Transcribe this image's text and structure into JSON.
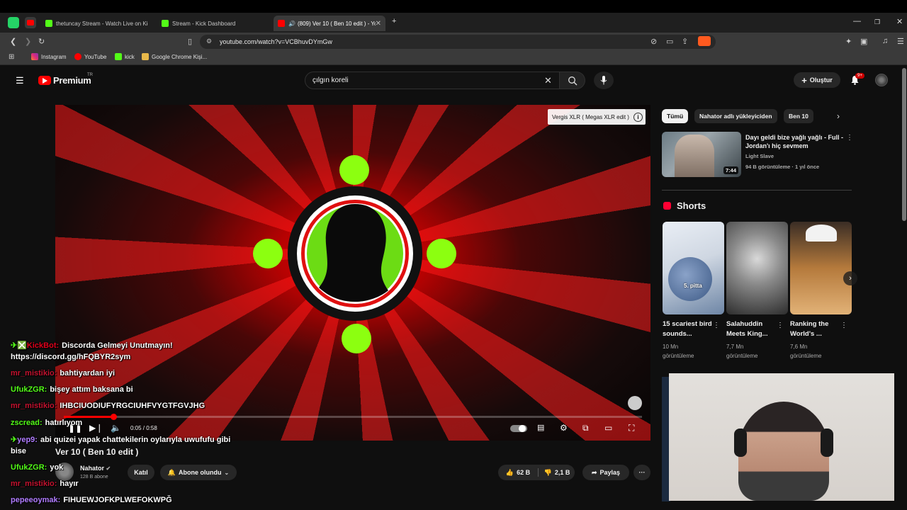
{
  "browser": {
    "tabs": [
      {
        "label": "thetuncay Stream - Watch Live on Kick",
        "active": false
      },
      {
        "label": "Stream - Kick Dashboard",
        "active": false
      },
      {
        "label": "(809) Ver 10 ( Ben 10 edit ) - YouTube",
        "active": true
      }
    ],
    "url": "youtube.com/watch?v=VCBhuvDYmGw",
    "bookmarks": [
      "Instagram",
      "YouTube",
      "kick",
      "Google Chrome Kişi..."
    ]
  },
  "youtube": {
    "logo": "Premium",
    "logo_region": "TR",
    "search_value": "çılgın koreli",
    "create_label": "Oluştur",
    "notif_badge": "9+"
  },
  "video": {
    "overlay_card": "Vergis XLR ( Megas XLR edit )",
    "time": "0:05 / 0:58",
    "progress": 0.086,
    "title": "Ver 10 ( Ben 10 edit )",
    "channel": "Nahator",
    "subscribers": "128 B abone",
    "join_label": "Katıl",
    "subscribed_label": "Abone olundu",
    "likes": "62 B",
    "dislikes": "2,1 B",
    "share_label": "Paylaş"
  },
  "chat": [
    {
      "user": "KickBot:",
      "text": "Discorda Gelmeyi Unutmayın!",
      "user_color": "#e0001b",
      "prefix": "✈❎"
    },
    {
      "user": "",
      "text": "https://discord.gg/hFQBYR2sym",
      "user_color": "#ffffff",
      "prefix": ""
    },
    {
      "user": "mr_mistikio:",
      "text": "bahtiyardan iyi",
      "user_color": "#c4122f",
      "prefix": ""
    },
    {
      "user": "UfukZGR:",
      "text": "bişey attım baksana bi",
      "user_color": "#53fc18",
      "prefix": ""
    },
    {
      "user": "mr_mistikio:",
      "text": "IHBCIUODIUFYRGCIUHFVYGTFGVJHG",
      "user_color": "#c4122f",
      "prefix": ""
    },
    {
      "user": "zscread:",
      "text": "hatırlıyom",
      "user_color": "#53fc18",
      "prefix": ""
    },
    {
      "user": "yep9:",
      "text": "abi quizei yapak chattekilerin oylarıyla uwufufu gibi",
      "user_color": "#b07cff",
      "prefix": "✈"
    },
    {
      "user": "",
      "text": "bise",
      "user_color": "#ffffff",
      "prefix": ""
    },
    {
      "user": "UfukZGR:",
      "text": "yok",
      "user_color": "#53fc18",
      "prefix": ""
    },
    {
      "user": "mr_mistikio:",
      "text": "hayır",
      "user_color": "#c4122f",
      "prefix": ""
    },
    {
      "user": "pepeeoymak:",
      "text": "FIHUEWJOFKPLWEFOKWPĞ",
      "user_color": "#b07cff",
      "prefix": ""
    }
  ],
  "sidebar": {
    "chips": [
      "Tümü",
      "Nahator adlı yükleyiciden",
      "Ben 10"
    ],
    "related": {
      "title": "Dayı geldi bize yağlı yağlı - Full - Jordan'ı hiç sevmem",
      "channel": "Light Slave",
      "meta": "94 B görüntüleme · 1 yıl önce",
      "duration": "7:44"
    },
    "shorts_label": "Shorts",
    "shorts": [
      {
        "title": "15 scariest bird sounds...",
        "views": "10 Mn",
        "views_label": "görüntüleme",
        "overlay": "5. pitta"
      },
      {
        "title": "Salahuddin Meets King...",
        "views": "7,7 Mn",
        "views_label": "görüntüleme",
        "overlay": ""
      },
      {
        "title": "Ranking the World's ...",
        "views": "7,6 Mn",
        "views_label": "görüntüleme",
        "overlay": ""
      }
    ]
  }
}
